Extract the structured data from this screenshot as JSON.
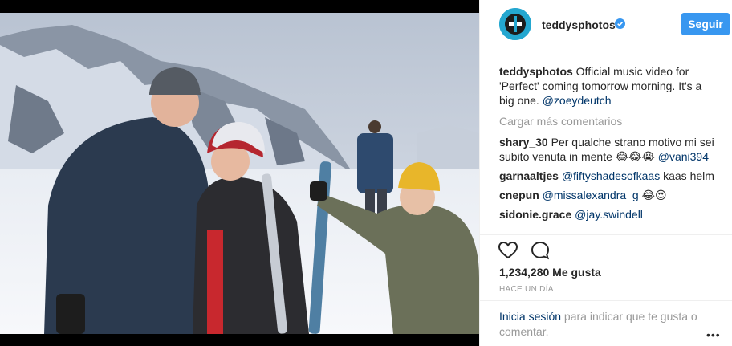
{
  "post": {
    "username": "teddysphotos",
    "follow_label": "Seguir",
    "caption_user": "teddysphotos",
    "caption_text": " Official music video for 'Perfect' coming tomorrow morning. It's a big one. ",
    "caption_mention": "@zoeydeutch",
    "load_more": "Cargar más comentarios",
    "comments": [
      {
        "user": "shary_30",
        "text": " Per qualche strano motivo mi sei subito venuta in mente 😂😂😭 ",
        "mention": "@vani394",
        "after": ""
      },
      {
        "user": "garnaaltjes",
        "text": " ",
        "mention": "@fiftyshadesofkaas",
        "after": " kaas helm"
      },
      {
        "user": "cnepun",
        "text": " ",
        "mention": "@missalexandra_g",
        "after": " 😂😍"
      },
      {
        "user": "sidonie.grace",
        "text": " ",
        "mention": "@jay.swindell",
        "after": ""
      }
    ],
    "likes": "1,234,280 Me gusta",
    "time": "HACE UN DÍA",
    "login_link": "Inicia sesión",
    "login_text": " para indicar que te gusta o comentar.",
    "more": "•••"
  },
  "icons": {
    "verified": "verified-badge-icon",
    "heart": "heart-icon",
    "comment": "comment-icon",
    "more": "more-options-icon"
  },
  "colors": {
    "accent": "#3897f0",
    "link": "#003569",
    "muted": "#999999",
    "avatar_bg": "#24a7d0"
  }
}
